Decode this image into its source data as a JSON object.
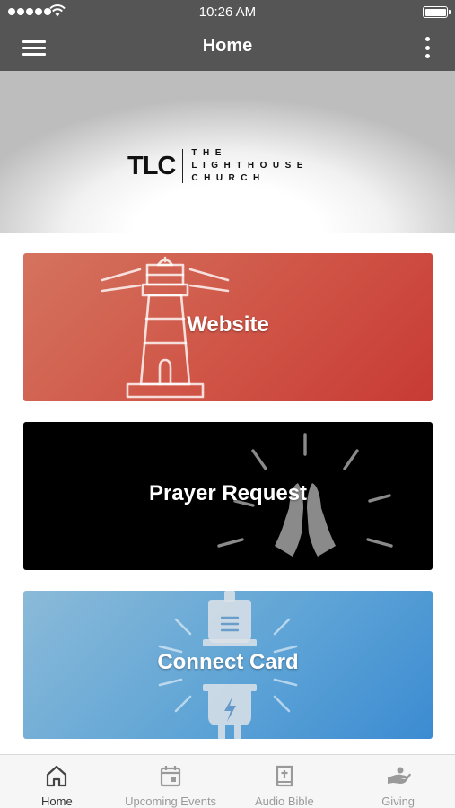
{
  "status_bar": {
    "time": "10:26 AM",
    "signal_icon": "signal-dots-icon",
    "wifi_icon": "wifi-icon",
    "battery_icon": "battery-icon",
    "battery_level": 1.0
  },
  "app_bar": {
    "title": "Home",
    "menu_icon": "hamburger-menu-icon",
    "more_icon": "more-vertical-icon",
    "background_color": "#555555"
  },
  "hero": {
    "logo": {
      "mark": "TLC",
      "lines": [
        "THE",
        "LIGHTHOUSE",
        "CHURCH"
      ]
    }
  },
  "cards": [
    {
      "label": "Website",
      "icon": "lighthouse-icon",
      "color": "#cf5144"
    },
    {
      "label": "Prayer Request",
      "icon": "praying-hands-icon",
      "color": "#000000"
    },
    {
      "label": "Connect Card",
      "icon": "plug-icon",
      "color": "#5ea4d6"
    }
  ],
  "tab_bar": {
    "tabs": [
      {
        "label": "Home",
        "icon": "home-icon",
        "active": true
      },
      {
        "label": "Upcoming Events",
        "icon": "calendar-icon",
        "active": false
      },
      {
        "label": "Audio Bible",
        "icon": "bible-icon",
        "active": false
      },
      {
        "label": "Giving",
        "icon": "giving-hand-icon",
        "active": false
      }
    ]
  }
}
